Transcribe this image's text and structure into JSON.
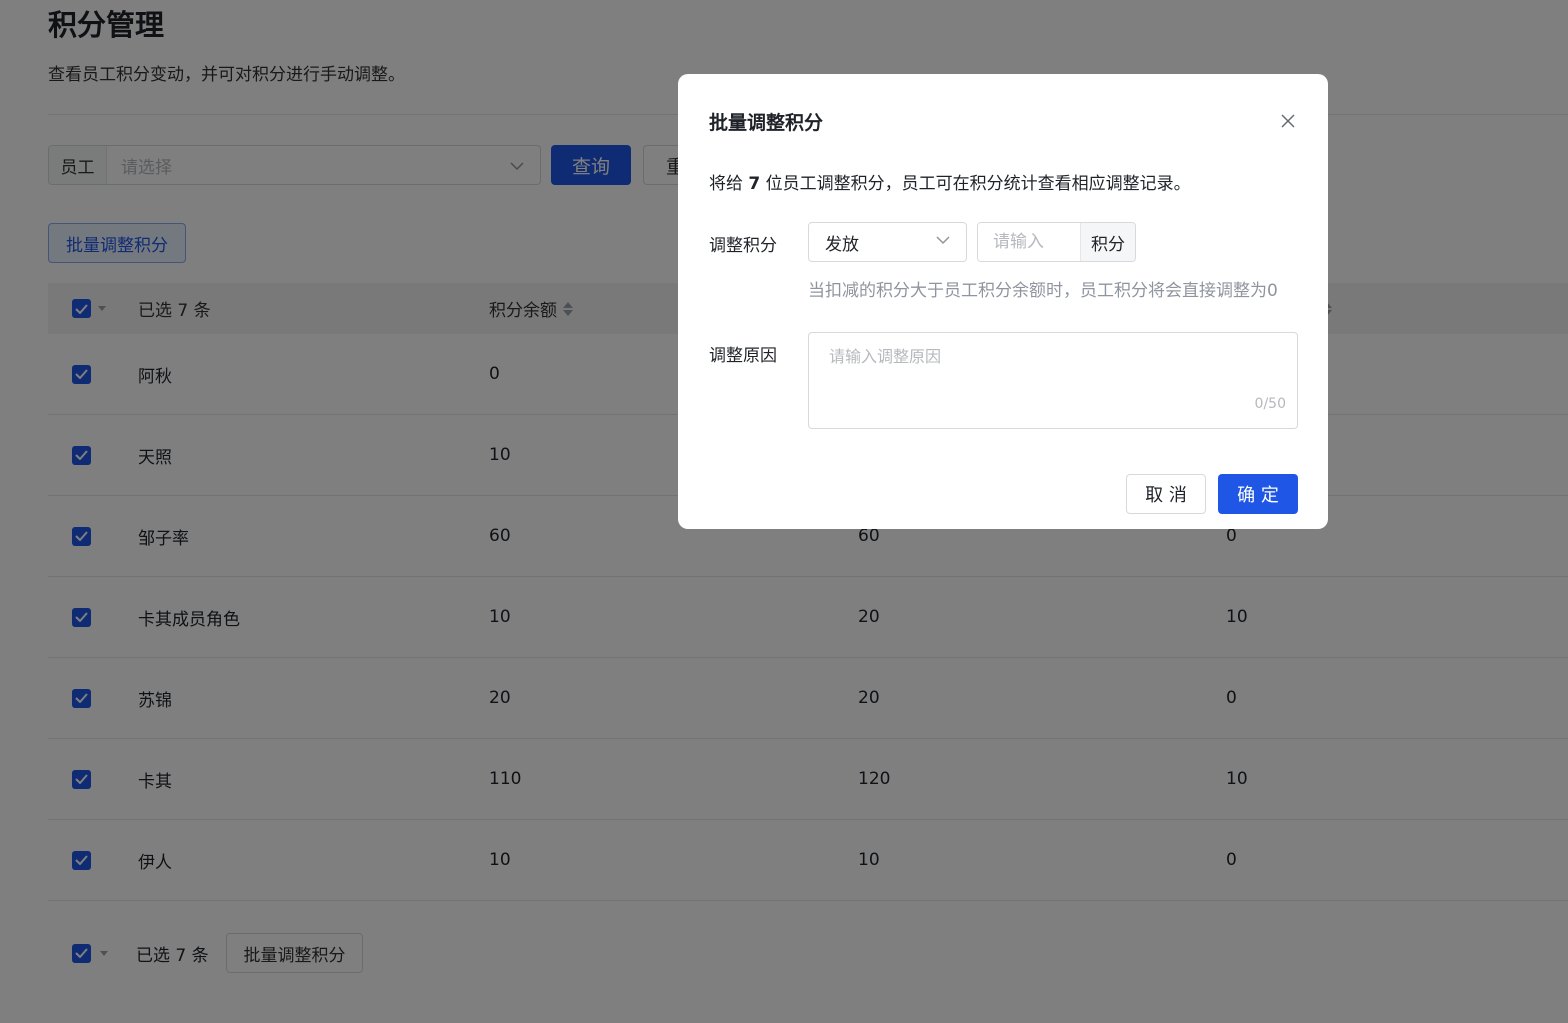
{
  "page": {
    "title": "积分管理",
    "description": "查看员工积分变动，并可对积分进行手动调整。"
  },
  "filter": {
    "label": "员工",
    "placeholder": "请选择",
    "query_label": "查询",
    "reset_label": "重置"
  },
  "batch_button": "批量调整积分",
  "table": {
    "selected_text": "已选 7 条",
    "columns": [
      "积分余额"
    ],
    "rows": [
      {
        "name": "阿秋",
        "balance": "0",
        "col3": "",
        "col4": ""
      },
      {
        "name": "天照",
        "balance": "10",
        "col3": "",
        "col4": ""
      },
      {
        "name": "邹子率",
        "balance": "60",
        "col3": "60",
        "col4": "0"
      },
      {
        "name": "卡其成员角色",
        "balance": "10",
        "col3": "20",
        "col4": "10"
      },
      {
        "name": "苏锦",
        "balance": "20",
        "col3": "20",
        "col4": "0"
      },
      {
        "name": "卡其",
        "balance": "110",
        "col3": "120",
        "col4": "10"
      },
      {
        "name": "伊人",
        "balance": "10",
        "col3": "10",
        "col4": "0"
      }
    ]
  },
  "footer": {
    "selected_text": "已选 7 条",
    "batch_label": "批量调整积分"
  },
  "modal": {
    "title": "批量调整积分",
    "msg_prefix": "将给",
    "msg_count": "7",
    "msg_suffix": "位员工调整积分，员工可在积分统计查看相应调整记录。",
    "adjust_label": "调整积分",
    "type_value": "发放",
    "points_placeholder": "请输入",
    "points_suffix": "积分",
    "hint": "当扣减的积分大于员工积分余额时，员工积分将会直接调整为0",
    "reason_label": "调整原因",
    "reason_placeholder": "请输入调整原因",
    "reason_counter": "0/50",
    "cancel_label": "取 消",
    "ok_label": "确 定"
  },
  "colors": {
    "primary": "#1f56e6",
    "overlay": "rgba(0,0,0,0.5)"
  },
  "icons": [
    "chevron-down-icon",
    "close-icon",
    "check-icon",
    "sort-icon"
  ]
}
